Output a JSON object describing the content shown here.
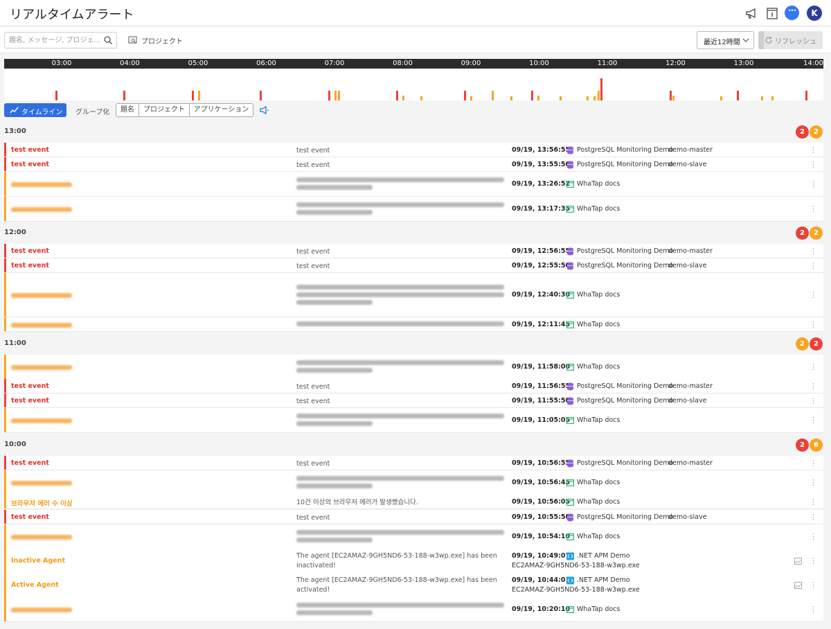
{
  "header": {
    "title": "リアルタイムアラート",
    "icons": [
      "megaphone-icon",
      "info-panel-icon",
      "chat-icon"
    ],
    "avatar_initial": "K"
  },
  "toolbar": {
    "search_placeholder": "題名, メッセージ, プロジェ...",
    "project_filter_label": "プロジェクト",
    "range_label": "最近12時間",
    "refresh_label": "リフレッシュ",
    "refresh_progress": 0.09
  },
  "timeline": {
    "ticks": [
      "03:00",
      "04:00",
      "05:00",
      "06:00",
      "07:00",
      "08:00",
      "09:00",
      "10:00",
      "11:00",
      "12:00",
      "13:00",
      "14:00"
    ],
    "colors": {
      "critical": "#e8423a",
      "warning": "#f5a623"
    }
  },
  "view": {
    "timeline_label": "タイムライン",
    "group_label": "グループ化",
    "seg_title": "題名",
    "seg_project": "プロジェクト",
    "seg_app": "アプリケーション"
  },
  "groups": [
    {
      "time": "13:00",
      "badges": [
        "2",
        "2"
      ],
      "rows": [
        {
          "title": "test event",
          "msg": "test event",
          "ts": "09/19, 13:56:55",
          "project": "PostgreSQL Monitoring Demo",
          "agent": "demo-master"
        },
        {
          "title": "test event",
          "msg": "test event",
          "ts": "09/19, 13:55:50",
          "project": "PostgreSQL Monitoring Demo",
          "agent": "demo-slave"
        },
        {
          "ts": "09/19, 13:26:52",
          "project": "WhaTap docs"
        },
        {
          "ts": "09/19, 13:17:35",
          "project": "WhaTap docs"
        }
      ]
    },
    {
      "time": "12:00",
      "badges": [
        "2",
        "2"
      ],
      "rows": [
        {
          "title": "test event",
          "msg": "test event",
          "ts": "09/19, 12:56:55",
          "project": "PostgreSQL Monitoring Demo",
          "agent": "demo-master"
        },
        {
          "title": "test event",
          "msg": "test event",
          "ts": "09/19, 12:55:50",
          "project": "PostgreSQL Monitoring Demo",
          "agent": "demo-slave"
        },
        {
          "ts": "09/19, 12:40:30",
          "project": "WhaTap docs"
        },
        {
          "ts": "09/19, 12:11:45",
          "project": "WhaTap docs"
        }
      ]
    },
    {
      "time": "11:00",
      "badges": [
        "2",
        "2"
      ],
      "rows": [
        {
          "ts": "09/19, 11:58:00",
          "project": "WhaTap docs"
        },
        {
          "title": "test event",
          "msg": "test event",
          "ts": "09/19, 11:56:55",
          "project": "PostgreSQL Monitoring Demo",
          "agent": "demo-master"
        },
        {
          "title": "test event",
          "msg": "test event",
          "ts": "09/19, 11:55:50",
          "project": "PostgreSQL Monitoring Demo",
          "agent": "demo-slave"
        },
        {
          "ts": "09/19, 11:05:05",
          "project": "WhaTap docs"
        }
      ]
    },
    {
      "time": "10:00",
      "badges": [
        "2",
        "6"
      ],
      "rows": [
        {
          "title": "test event",
          "msg": "test event",
          "ts": "09/19, 10:56:55",
          "project": "PostgreSQL Monitoring Demo",
          "agent": "demo-master"
        },
        {
          "ts": "09/19, 10:56:45",
          "project": "WhaTap docs"
        },
        {
          "title": "브라우저 에러 수 이상",
          "msg": "10건 이상의 브라우저 에러가 발생했습니다.",
          "ts": "09/19, 10:56:05",
          "project": "WhaTap docs"
        },
        {
          "title": "test event",
          "msg": "test event",
          "ts": "09/19, 10:55:50",
          "project": "PostgreSQL Monitoring Demo",
          "agent": "demo-slave"
        },
        {
          "ts": "09/19, 10:54:10",
          "project": "WhaTap docs"
        },
        {
          "title": "Inactive Agent",
          "msg": "The agent [EC2AMAZ-9GH5ND6-53-188-w3wp.exe] has been inactivated!",
          "ts": "09/19, 10:49:07",
          "project": ".NET APM Demo",
          "sub": "EC2AMAZ-9GH5ND6-53-188-w3wp.exe"
        },
        {
          "title": "Active Agent",
          "msg": "The agent [EC2AMAZ-9GH5ND6-53-188-w3wp.exe] has been activated!",
          "ts": "09/19, 10:44:01",
          "project": ".NET APM Demo",
          "sub": "EC2AMAZ-9GH5ND6-53-188-w3wp.exe"
        },
        {
          "ts": "09/19, 10:20:10",
          "project": "WhaTap docs"
        }
      ]
    }
  ]
}
